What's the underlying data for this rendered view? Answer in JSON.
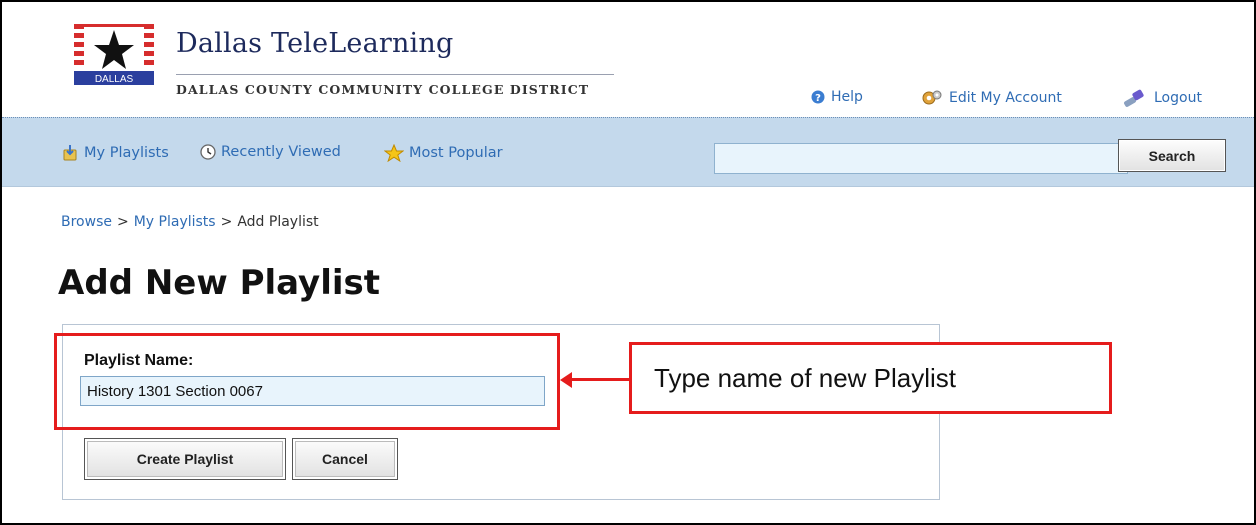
{
  "brand": {
    "title": "Dallas TeleLearning",
    "subtitle": "DALLAS COUNTY COMMUNITY COLLEGE DISTRICT",
    "logo_icon": "dallas-star-flag-logo",
    "logo_text": "DALLAS"
  },
  "toplinks": [
    {
      "label": "Help",
      "icon": "help-icon"
    },
    {
      "label": "Edit My Account",
      "icon": "gears-icon"
    },
    {
      "label": "Logout",
      "icon": "plug-icon"
    }
  ],
  "nav": [
    {
      "label": "My Playlists",
      "icon": "playlist-icon"
    },
    {
      "label": "Recently Viewed",
      "icon": "clock-icon"
    },
    {
      "label": "Most Popular",
      "icon": "star-icon"
    }
  ],
  "search": {
    "value": "",
    "button_label": "Search"
  },
  "breadcrumb": {
    "browse": "Browse",
    "separator": ">",
    "my_playlists": "My Playlists",
    "current": "Add Playlist"
  },
  "page_title": "Add New Playlist",
  "form": {
    "label": "Playlist Name:",
    "value": "History 1301 Section 0067",
    "create_label": "Create Playlist",
    "cancel_label": "Cancel"
  },
  "annotation": {
    "text": "Type name of new Playlist"
  },
  "colors": {
    "link": "#2f6cb4",
    "nav_band": "#c4d9ec",
    "annotation": "#e51c1c",
    "brand_navy": "#1d2a5c"
  }
}
